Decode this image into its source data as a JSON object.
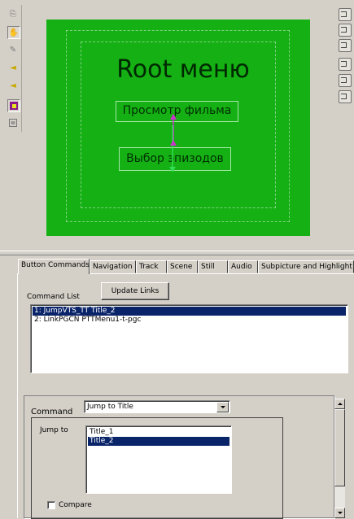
{
  "preview": {
    "menu_title": "Root меню",
    "buttons": [
      {
        "label": "Просмотр фильма"
      },
      {
        "label": "Выбор эпизодов"
      }
    ],
    "colors": {
      "background": "#14b014",
      "guide": "#7fd27f",
      "nav_up": "#cc33cc",
      "nav_down": "#33dd55"
    }
  },
  "left_toolbar": {
    "icons": [
      "select-tool-icon",
      "hand-tool-icon",
      "text-tool-icon",
      "audio-in-icon",
      "audio-out-icon",
      "button-highlight-icon",
      "frame-icon"
    ]
  },
  "right_toolbar": {
    "icons": [
      "align-left-icon",
      "align-center-icon",
      "align-right-icon",
      "align-top-icon",
      "align-middle-icon",
      "align-bottom-icon"
    ]
  },
  "tabs": [
    {
      "label": "Button Commands",
      "active": true
    },
    {
      "label": "Navigation"
    },
    {
      "label": "Track"
    },
    {
      "label": "Scene"
    },
    {
      "label": "Still"
    },
    {
      "label": "Audio"
    },
    {
      "label": "Subpicture and Highlight"
    }
  ],
  "commands": {
    "update_links_label": "Update Links",
    "list_label": "Command List",
    "items": [
      {
        "text": "1: JumpVTS_TT Title_2",
        "selected": true
      },
      {
        "text": "2: LinkPGCN PTTMenu1-t-pgc",
        "selected": false
      }
    ]
  },
  "editor": {
    "command_label": "Command",
    "command_value": "Jump to Title",
    "jump_to_label": "Jump to",
    "titles": [
      {
        "text": "Title_1",
        "selected": false
      },
      {
        "text": "Title_2",
        "selected": true
      }
    ],
    "compare_label": "Compare",
    "compare_checked": false
  }
}
